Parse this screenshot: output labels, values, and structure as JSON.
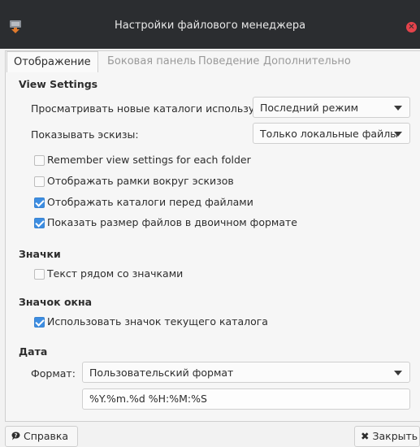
{
  "window": {
    "title": "Настройки файлового менеджера",
    "close_glyph": "✕"
  },
  "tabs": [
    {
      "label": "Отображение",
      "active": true
    },
    {
      "label": "Боковая панель",
      "active": false
    },
    {
      "label": "Поведение",
      "active": false
    },
    {
      "label": "Дополнительно",
      "active": false
    }
  ],
  "view_settings": {
    "title": "View Settings",
    "new_folders_label": "Просматривать новые каталоги используя:",
    "new_folders_value": "Последний режим",
    "thumbnails_label": "Показывать эскизы:",
    "thumbnails_value": "Только локальные файлы",
    "checkboxes": [
      {
        "label": "Remember view settings for each folder",
        "checked": false
      },
      {
        "label": "Отображать рамки вокруг эскизов",
        "checked": false
      },
      {
        "label": "Отображать каталоги перед файлами",
        "checked": true
      },
      {
        "label": "Показать размер файлов в двоичном формате",
        "checked": true
      }
    ]
  },
  "icons_section": {
    "title": "Значки",
    "checkboxes": [
      {
        "label": "Текст рядом со значками",
        "checked": false
      }
    ]
  },
  "window_icon": {
    "title": "Значок окна",
    "checkboxes": [
      {
        "label": "Использовать значок текущего каталога",
        "checked": true
      }
    ]
  },
  "date": {
    "title": "Дата",
    "format_label": "Формат:",
    "format_value": "Пользовательский формат",
    "custom_format": "%Y.%m.%d %H:%M:%S"
  },
  "footer": {
    "help_label": "Справка",
    "help_icon": "help-icon",
    "close_label": "Закрыть",
    "close_icon": "close-icon"
  },
  "colors": {
    "accent": "#3d8de1",
    "titlebar": "#2b2d30",
    "close": "#e5434b"
  }
}
